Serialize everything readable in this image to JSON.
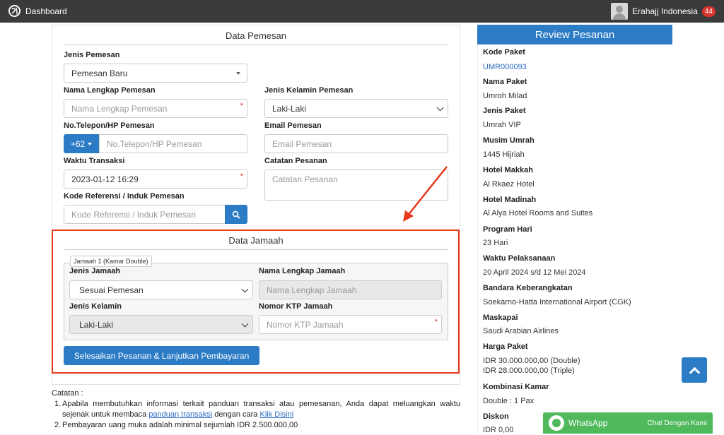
{
  "topbar": {
    "title": "Dashboard",
    "user_name": "Erahajj Indonesia",
    "notif_count": "44"
  },
  "form": {
    "section_title": "Data Pemesan",
    "jenis_pemesan_label": "Jenis Pemesan",
    "jenis_pemesan_value": "Pemesan Baru",
    "nama_label": "Nama Lengkap Pemesan",
    "nama_placeholder": "Nama Lengkap Pemesan",
    "kelamin_label": "Jenis Kelamin Pemesan",
    "kelamin_value": "Laki-Laki",
    "telp_label": "No.Telepon/HP Pemesan",
    "telp_prefix": "+62",
    "telp_placeholder": "No.Telepon/HP Pemesan",
    "email_label": "Email Pemesan",
    "email_placeholder": "Email Pemesan",
    "waktu_label": "Waktu Transaksi",
    "waktu_value": "2023-01-12 16:29",
    "catatan_label": "Catatan Pesanan",
    "catatan_placeholder": "Catatan Pesanan",
    "ref_label": "Kode Referensi / Induk Pemesan",
    "ref_placeholder": "Kode Referensi / Induk Pemesan",
    "required_mark": "*"
  },
  "jamaah": {
    "section_title": "Data Jamaah",
    "legend": "Jamaah 1 (Kamar Double)",
    "jenis_label": "Jenis Jamaah",
    "jenis_value": "Sesuai Pemesan",
    "nama_label": "Nama Lengkap Jamaah",
    "nama_placeholder": "Nama Lengkap Jamaah",
    "kelamin_label": "Jenis Kelamin",
    "kelamin_value": "Laki-Laki",
    "ktp_label": "Nomor KTP Jamaah",
    "ktp_placeholder": "Nomor KTP Jamaah",
    "submit_label": "Selesaikan Pesanan & Lanjutkan Pembayaran"
  },
  "notes": {
    "heading": "Catatan :",
    "item1_prefix": "Apabila membutuhkan informasi terkait panduan transaksi atau pemesanan, Anda dapat meluangkan waktu sejenak untuk membaca ",
    "item1_link": "panduan transaksi",
    "item1_mid": " dengan cara ",
    "item1_link2": "Klik Disini",
    "item2": "Pembayaran uang muka adalah minimal sejumlah IDR 2.500.000,00"
  },
  "review": {
    "title": "Review Pesanan",
    "items": [
      {
        "label": "Kode Paket",
        "value": "UMR000093"
      },
      {
        "label": "Nama Paket",
        "value": "Umroh Milad"
      },
      {
        "label": "Jenis Paket",
        "value": "Umrah VIP"
      },
      {
        "label": "Musim Umrah",
        "value": "1445 Hijriah"
      },
      {
        "label": "Hotel Makkah",
        "value": "Al Rkaez Hotel"
      },
      {
        "label": "Hotel Madinah",
        "value": "Al Alya Hotel Rooms and Suites"
      },
      {
        "label": "Program Hari",
        "value": "23 Hari"
      },
      {
        "label": "Waktu Pelaksanaan",
        "value": "20 April 2024 s/d 12 Mei 2024"
      },
      {
        "label": "Bandara Keberangkatan",
        "value": "Soekarno-Hatta International Airport (CGK)"
      },
      {
        "label": "Maskapai",
        "value": "Saudi Arabian Airlines"
      },
      {
        "label": "Harga Paket",
        "value": "IDR 30.000.000,00  (Double)",
        "value2": "IDR 28.000.000,00  (Triple)"
      },
      {
        "label": "Kombinasi Kamar",
        "value": "Double : 1  Pax"
      },
      {
        "label": "Diskon",
        "value": "IDR 0,00"
      }
    ]
  },
  "whatsapp": {
    "label": "WhatsApp",
    "cta": "Chat Dengan Kami"
  },
  "colors": {
    "primary": "#2b7bc5",
    "highlight": "#e8391d",
    "whatsapp": "#4fb95b",
    "topbar": "#3a3a3a"
  }
}
